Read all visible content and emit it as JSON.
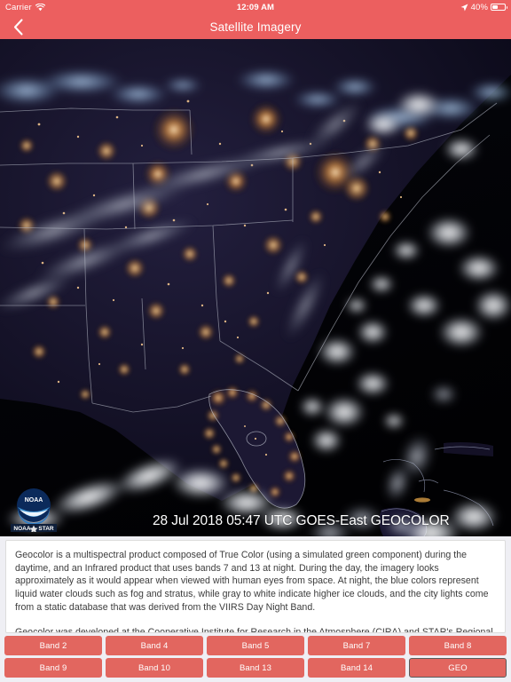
{
  "statusbar": {
    "carrier": "Carrier",
    "wifi_icon": "wifi-icon",
    "time": "12:09 AM",
    "location_icon": "location-arrow-icon",
    "battery_percent": "40%",
    "battery_icon": "battery-icon"
  },
  "navbar": {
    "back_icon": "chevron-left-icon",
    "title": "Satellite Imagery"
  },
  "satellite": {
    "timestamp_overlay": "28 Jul 2018 05:47 UTC GOES-East GEOCOLOR",
    "logo_primary": "NOAA",
    "logo_secondary_left": "NOAA",
    "logo_secondary_right": "STAR",
    "logo_name": "noaa-star-logo",
    "alt": "GOES-East GEOCOLOR nighttime satellite view of the southeastern United States and Florida"
  },
  "description": {
    "paragraph1": "Geocolor is a multispectral product composed of True Color (using a simulated green component) during the daytime, and an Infrared product that uses bands 7 and 13 at night. During the day, the imagery looks approximately as it would appear when viewed with human eyes from space. At night, the blue colors represent liquid water clouds such as fog and stratus, while gray to white indicate higher ice clouds, and the city lights come from a static database that was derived from the VIIRS Day Night Band.",
    "paragraph2": "Geocolor was developed at the Cooperative Institute for Research in the Atmosphere (CIRA) and STAR's Regional and Mesoscale Meteorology Branch (RAMMB)."
  },
  "bands": {
    "row1": [
      {
        "label": "Band 2",
        "selected": false
      },
      {
        "label": "Band 4",
        "selected": false
      },
      {
        "label": "Band 5",
        "selected": false
      },
      {
        "label": "Band 7",
        "selected": false
      },
      {
        "label": "Band 8",
        "selected": false
      }
    ],
    "row2": [
      {
        "label": "Band 9",
        "selected": false
      },
      {
        "label": "Band 10",
        "selected": false
      },
      {
        "label": "Band 13",
        "selected": false
      },
      {
        "label": "Band 14",
        "selected": false
      },
      {
        "label": "GEO",
        "selected": true
      }
    ]
  },
  "colors": {
    "accent": "#ec5f5f",
    "button": "#e2665f",
    "selected_border": "#5a5a5a",
    "page_bg": "#efeff4",
    "card_bg": "#ffffff",
    "text": "#3c3c3c"
  }
}
